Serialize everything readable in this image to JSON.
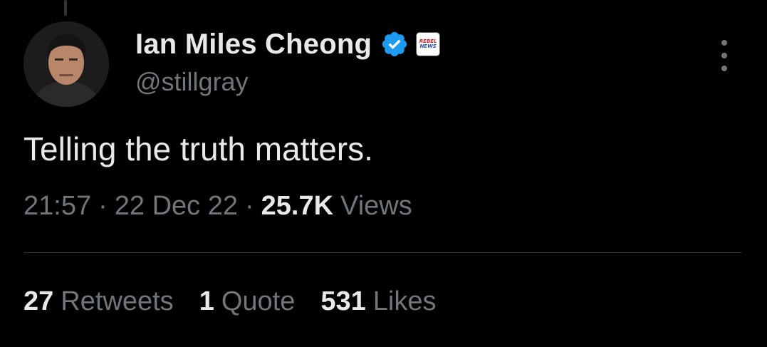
{
  "tweet": {
    "author": {
      "display_name": "Ian Miles Cheong",
      "handle": "@stillgray",
      "verified_icon": "verified-badge-icon",
      "affiliate_badge": {
        "icon": "rebel-news-badge",
        "line1": "REBEL",
        "line2": "NEWS"
      }
    },
    "text": "Telling the truth matters.",
    "time": "21:57",
    "date": "22 Dec 22",
    "separator": "·",
    "views_count": "25.7K",
    "views_label": "Views",
    "stats": {
      "retweets_count": "27",
      "retweets_label": "Retweets",
      "quotes_count": "1",
      "quotes_label": "Quote",
      "likes_count": "531",
      "likes_label": "Likes"
    },
    "more_icon": "more-vertical-icon"
  },
  "colors": {
    "background": "#000000",
    "primary_text": "#e7e9ea",
    "secondary_text": "#71767b",
    "verified_blue": "#1d9bf0",
    "divider": "#2f3336"
  }
}
